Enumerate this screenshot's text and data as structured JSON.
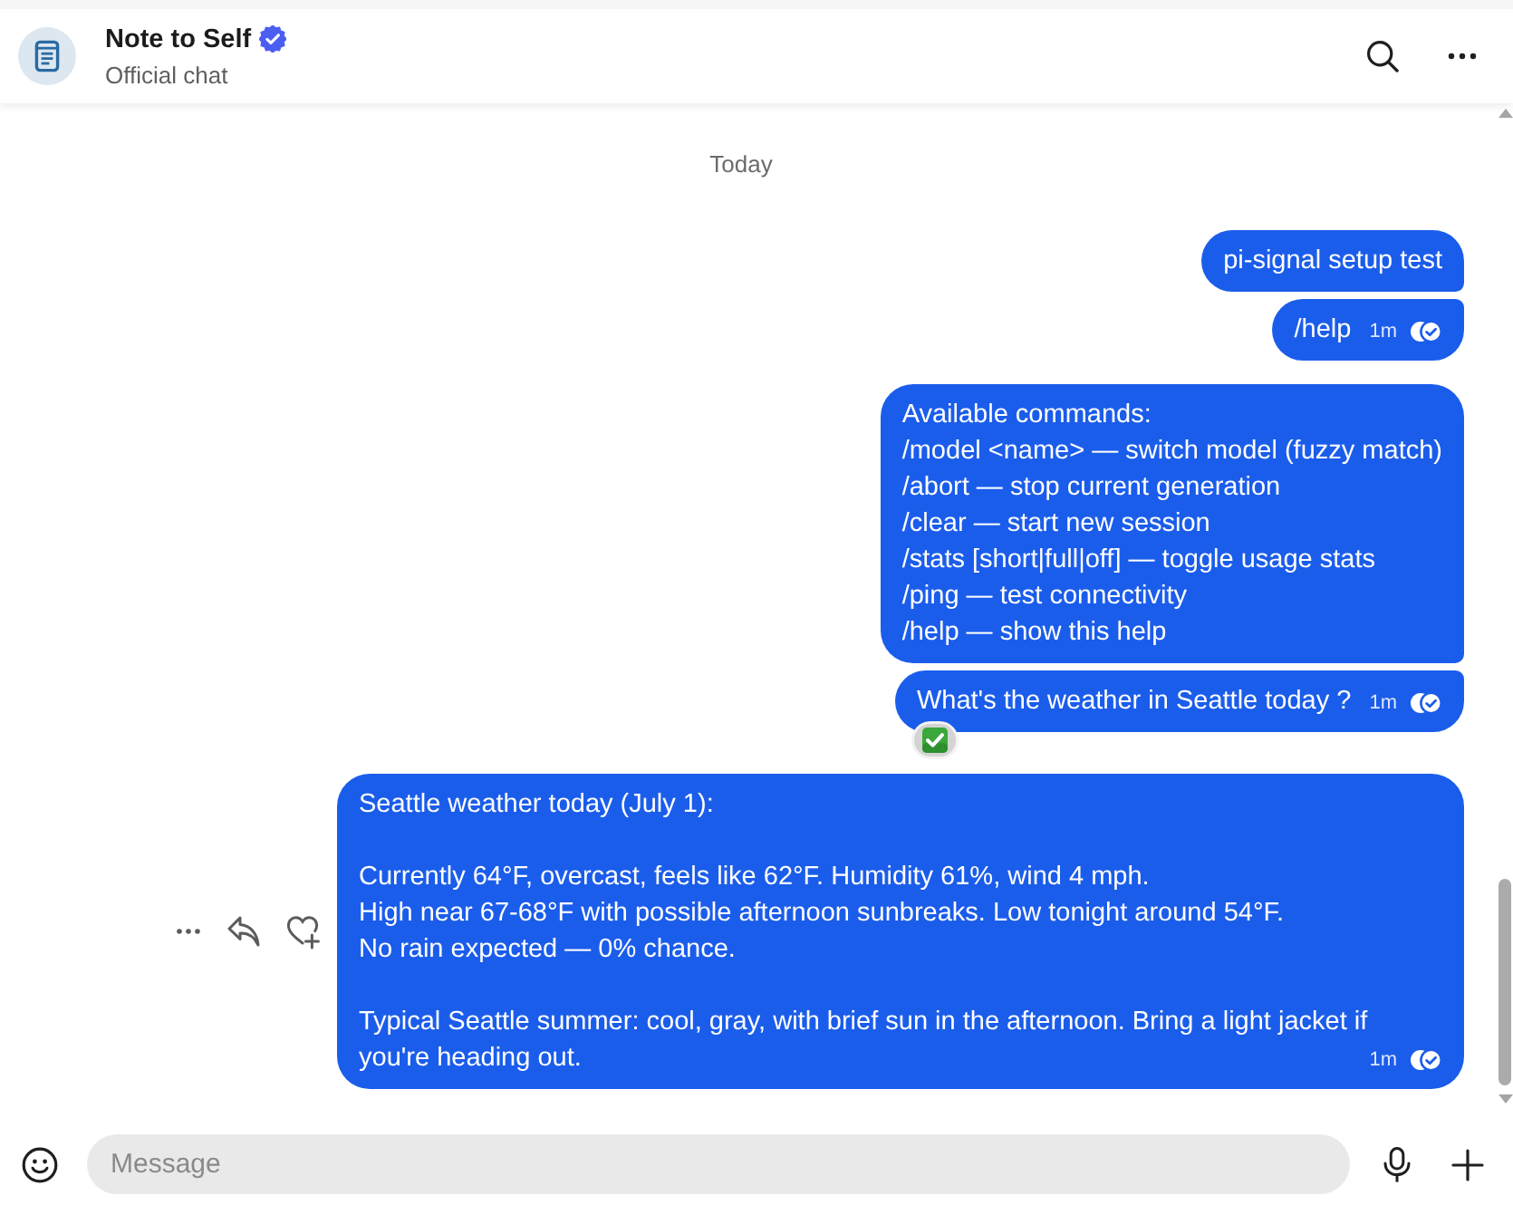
{
  "header": {
    "title": "Note to Self",
    "verified": true,
    "subtitle": "Official chat"
  },
  "date_divider": "Today",
  "message_groups": [
    {
      "messages": [
        {
          "text": "pi-signal setup test",
          "hovered": false
        },
        {
          "text": "/help",
          "time": "1m",
          "read": true,
          "hovered": false
        }
      ]
    },
    {
      "messages": [
        {
          "text": "Available commands:\n/model <name> — switch model (fuzzy match)\n/abort — stop current generation\n/clear — start new session\n/stats [short|full|off] — toggle usage stats\n/ping — test connectivity\n/help — show this help",
          "hovered": false
        },
        {
          "text": "What's the weather in Seattle today ?",
          "time": "1m",
          "read": true,
          "reacted": true,
          "hovered": false
        }
      ]
    },
    {
      "messages": [
        {
          "text": "Seattle weather today (July 1):\n\nCurrently 64°F, overcast, feels like 62°F. Humidity 61%, wind 4 mph.\nHigh near 67-68°F with possible afternoon sunbreaks. Low tonight around 54°F.\nNo rain expected — 0% chance.\n\nTypical Seattle summer: cool, gray, with brief sun in the afternoon. Bring a light jacket if you're heading out.",
          "time": "1m",
          "read": true,
          "hovered": true
        }
      ]
    }
  ],
  "composer": {
    "placeholder": "Message"
  }
}
